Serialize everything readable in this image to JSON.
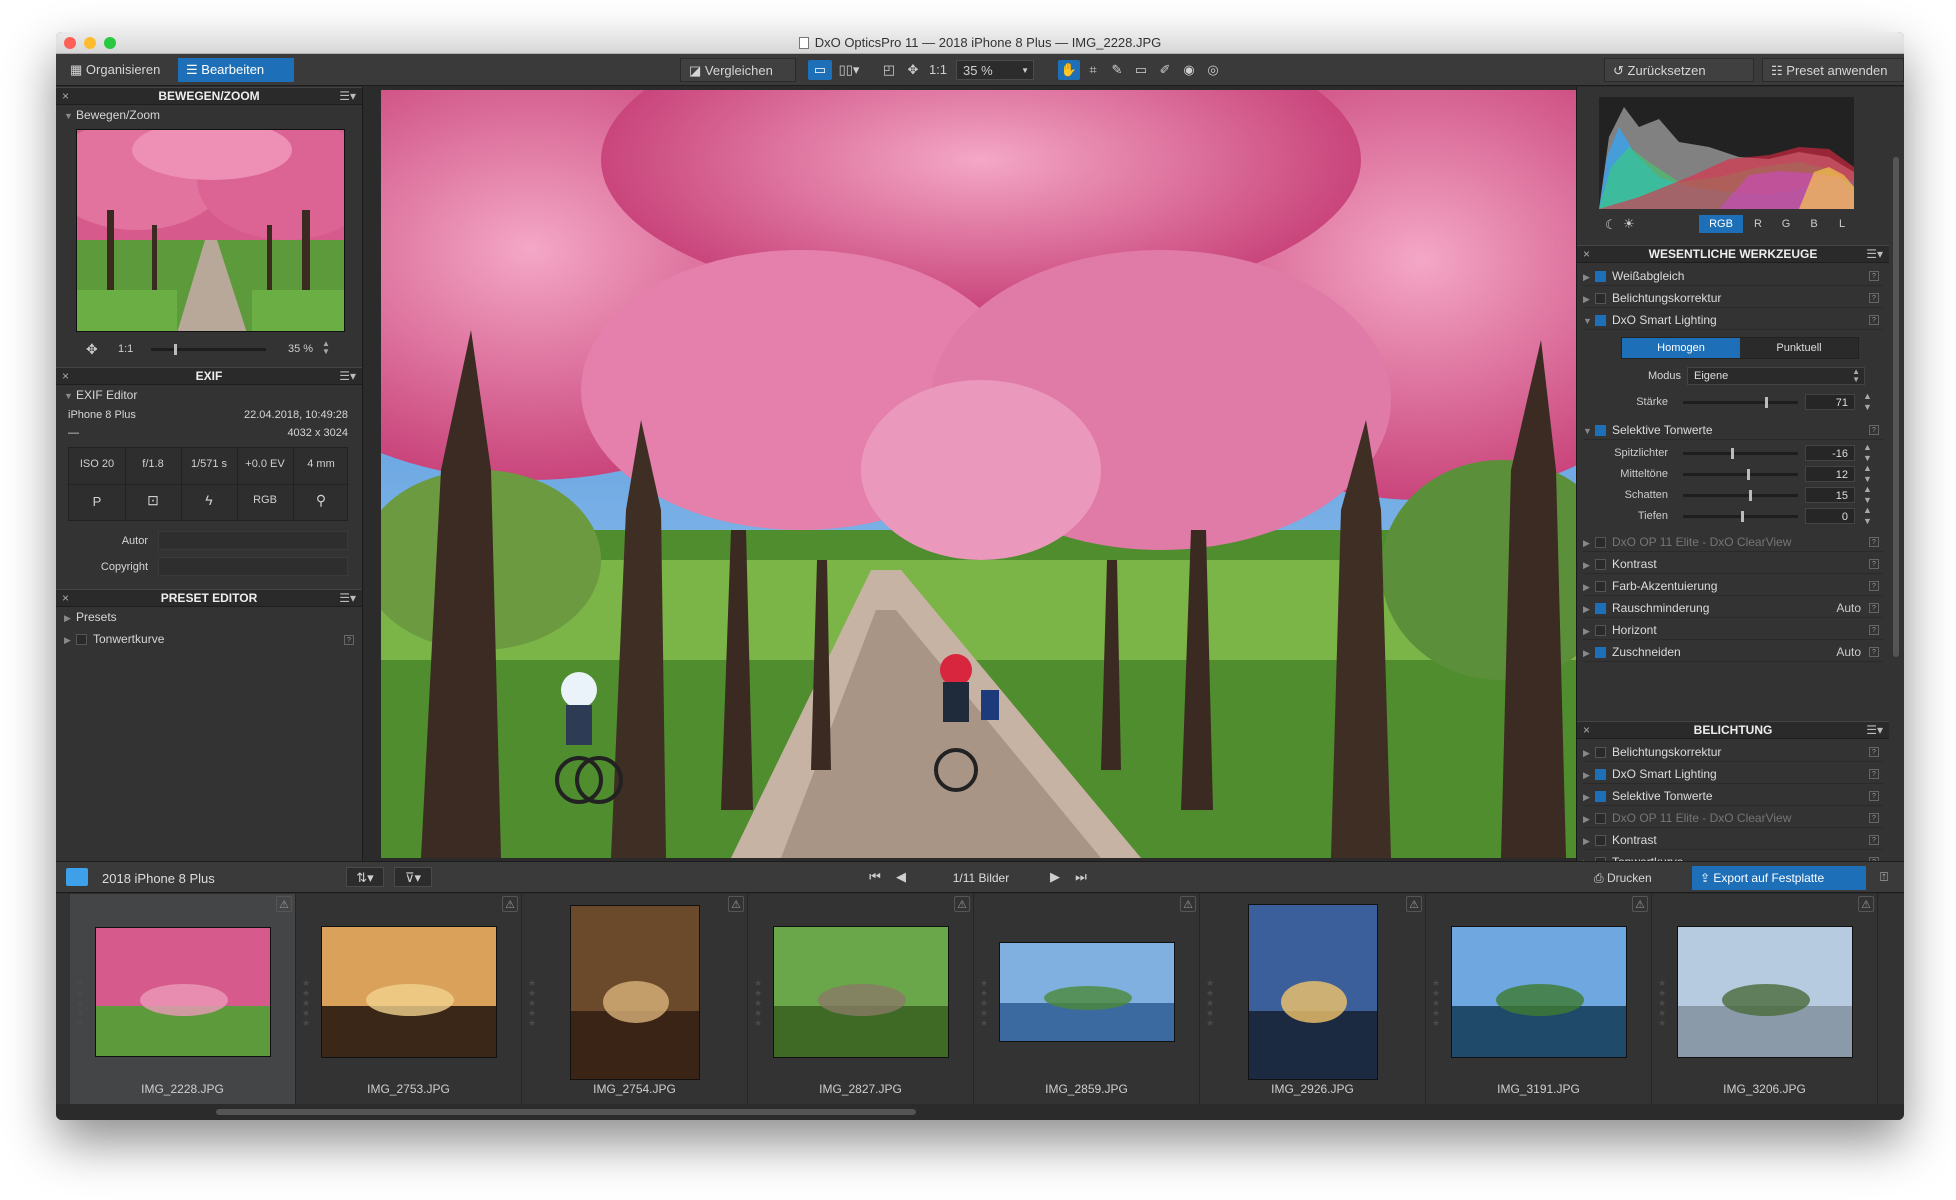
{
  "window": {
    "title": "DxO OpticsPro 11 — 2018 iPhone 8 Plus — IMG_2228.JPG"
  },
  "toolbar": {
    "organize": "Organisieren",
    "edit": "Bearbeiten",
    "compare": "Vergleichen",
    "ratio": "1:1",
    "zoom": "35 %",
    "reset": "Zurücksetzen",
    "preset": "Preset anwenden"
  },
  "left": {
    "pan_zoom": {
      "header": "BEWEGEN/ZOOM",
      "sub": "Bewegen/Zoom",
      "ratio": "1:1",
      "zoom": "35 %",
      "slider": 0.2
    },
    "exif": {
      "header": "EXIF",
      "sub": "EXIF Editor",
      "camera": "iPhone 8 Plus",
      "date": "22.04.2018, 10:49:28",
      "dash": "—",
      "dims": "4032 x 3024",
      "cells": [
        "ISO 20",
        "f/1.8",
        "1/571 s",
        "+0.0 EV",
        "4 mm"
      ],
      "mode": "P",
      "rgb": "RGB",
      "author_label": "Autor",
      "copyright_label": "Copyright"
    },
    "preset": {
      "header": "PRESET EDITOR",
      "items": [
        "Presets",
        "Tonwertkurve"
      ]
    }
  },
  "right": {
    "hist_channels": [
      "RGB",
      "R",
      "G",
      "B",
      "L"
    ],
    "essentials": {
      "header": "WESENTLICHE WERKZEUGE",
      "top": [
        {
          "label": "Weißabgleich",
          "on": true
        },
        {
          "label": "Belichtungskorrektur",
          "on": false
        },
        {
          "label": "DxO Smart Lighting",
          "on": true
        }
      ],
      "smart_tabs": [
        "Homogen",
        "Punktuell"
      ],
      "mode_label": "Modus",
      "mode_value": "Eigene",
      "strength_label": "Stärke",
      "strength": 71,
      "selective": "Selektive Tonwerte",
      "sliders": [
        {
          "label": "Spitzlichter",
          "value": -16
        },
        {
          "label": "Mitteltöne",
          "value": 12
        },
        {
          "label": "Schatten",
          "value": 15
        },
        {
          "label": "Tiefen",
          "value": 0
        }
      ],
      "rest": [
        {
          "label": "DxO OP 11 Elite - DxO ClearView",
          "dim": true,
          "on": false,
          "val": ""
        },
        {
          "label": "Kontrast",
          "dim": false,
          "on": false,
          "val": ""
        },
        {
          "label": "Farb-Akzentuierung",
          "dim": false,
          "on": false,
          "val": ""
        },
        {
          "label": "Rauschminderung",
          "dim": false,
          "on": true,
          "val": "Auto"
        },
        {
          "label": "Horizont",
          "dim": false,
          "on": false,
          "val": ""
        },
        {
          "label": "Zuschneiden",
          "dim": false,
          "on": true,
          "val": "Auto"
        }
      ]
    },
    "exposure": {
      "header": "BELICHTUNG",
      "items": [
        {
          "label": "Belichtungskorrektur",
          "dim": false,
          "on": false
        },
        {
          "label": "DxO Smart Lighting",
          "dim": false,
          "on": true
        },
        {
          "label": "Selektive Tonwerte",
          "dim": false,
          "on": true
        },
        {
          "label": "DxO OP 11 Elite - DxO ClearView",
          "dim": true,
          "on": false
        },
        {
          "label": "Kontrast",
          "dim": false,
          "on": false
        },
        {
          "label": "Tonwertkurve",
          "dim": false,
          "on": false
        }
      ]
    }
  },
  "filmbar": {
    "folder": "2018 iPhone 8 Plus",
    "count": "1/11 Bilder",
    "print": "Drucken",
    "export": "Export auf Festplatte"
  },
  "thumbs": [
    "IMG_2228.JPG",
    "IMG_2753.JPG",
    "IMG_2754.JPG",
    "IMG_2827.JPG",
    "IMG_2859.JPG",
    "IMG_2926.JPG",
    "IMG_3191.JPG",
    "IMG_3206.JPG"
  ],
  "colors": {
    "accent": "#1d6fb8"
  }
}
